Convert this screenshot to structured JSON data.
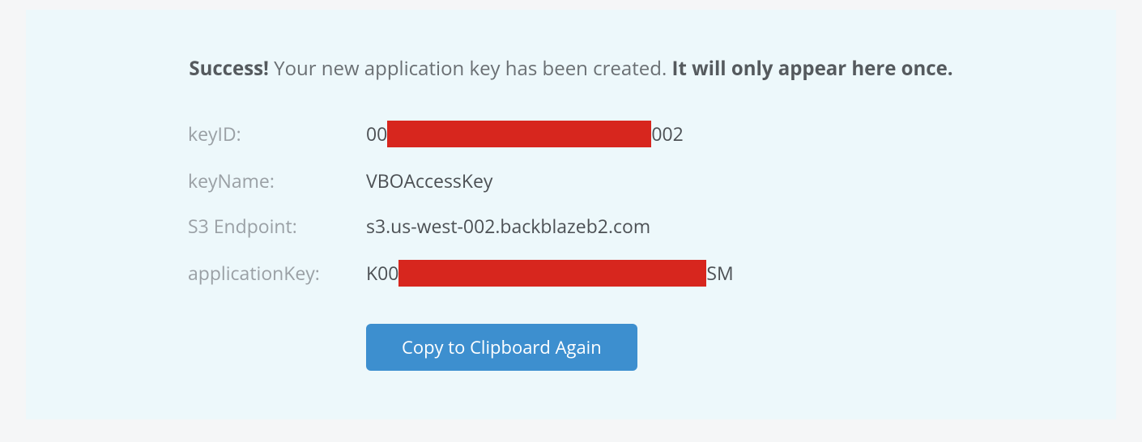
{
  "message": {
    "strong_prefix": "Success!",
    "middle": " Your new application key has been created. ",
    "strong_suffix": "It will only appear here once."
  },
  "fields": {
    "keyID": {
      "label": "keyID:",
      "prefix": "00",
      "suffix": "002"
    },
    "keyName": {
      "label": "keyName:",
      "value": "VBOAccessKey"
    },
    "s3Endpoint": {
      "label": "S3 Endpoint:",
      "value": "s3.us-west-002.backblazeb2.com"
    },
    "applicationKey": {
      "label": "applicationKey:",
      "prefix": "K00",
      "suffix": "SM"
    }
  },
  "button": {
    "copy": "Copy to Clipboard Again"
  },
  "colors": {
    "panel_bg": "#edf8fb",
    "page_bg": "#f5f6f7",
    "label_gray": "#9aa0a5",
    "value_gray": "#4c5054",
    "redaction": "#d7261e",
    "button_bg": "#3d8fcf",
    "button_text": "#ffffff"
  }
}
